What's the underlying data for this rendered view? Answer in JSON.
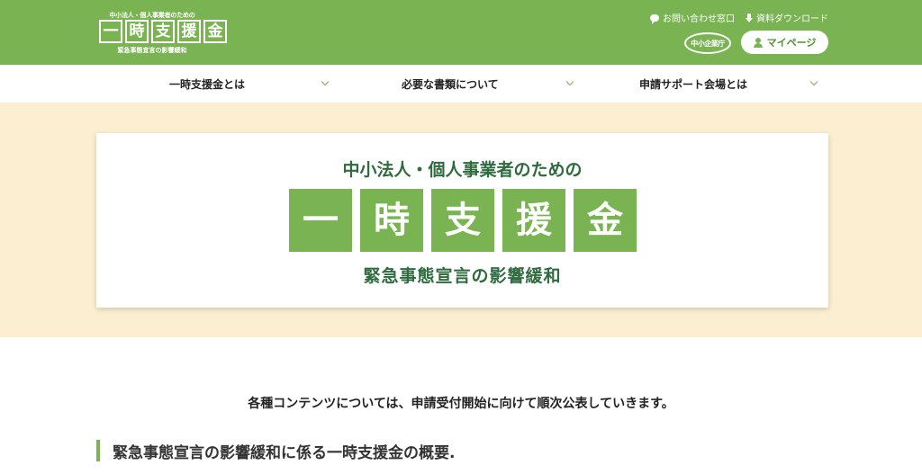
{
  "header": {
    "logo": {
      "top_text": "中小法人・個人事業者のための",
      "chars": [
        "一",
        "時",
        "支",
        "援",
        "金"
      ],
      "bottom_text": "緊急事態宣言の影響緩和"
    },
    "utility_links": [
      {
        "label": "お問い合わせ窓口",
        "icon": "chat-bubble-icon"
      },
      {
        "label": "資料ダウンロード",
        "icon": "download-icon"
      }
    ],
    "sme_logo_text": "中小企業庁",
    "mypage_label": "マイページ"
  },
  "nav": {
    "items": [
      {
        "label": "一時支援金とは"
      },
      {
        "label": "必要な書類について"
      },
      {
        "label": "申請サポート会場とは"
      }
    ]
  },
  "hero": {
    "lead": "中小法人・個人事業者のための",
    "chars": [
      "一",
      "時",
      "支",
      "援",
      "金"
    ],
    "sub": "緊急事態宣言の影響緩和"
  },
  "content": {
    "notice": "各種コンテンツについては、申請受付開始に向けて順次公表していきます。",
    "section_heading": "緊急事態宣言の影響緩和に係る一時支援金の概要."
  },
  "colors": {
    "brand_green": "#79b352",
    "dark_green_text": "#2f6b3e",
    "hero_bg": "#fcefd1"
  }
}
